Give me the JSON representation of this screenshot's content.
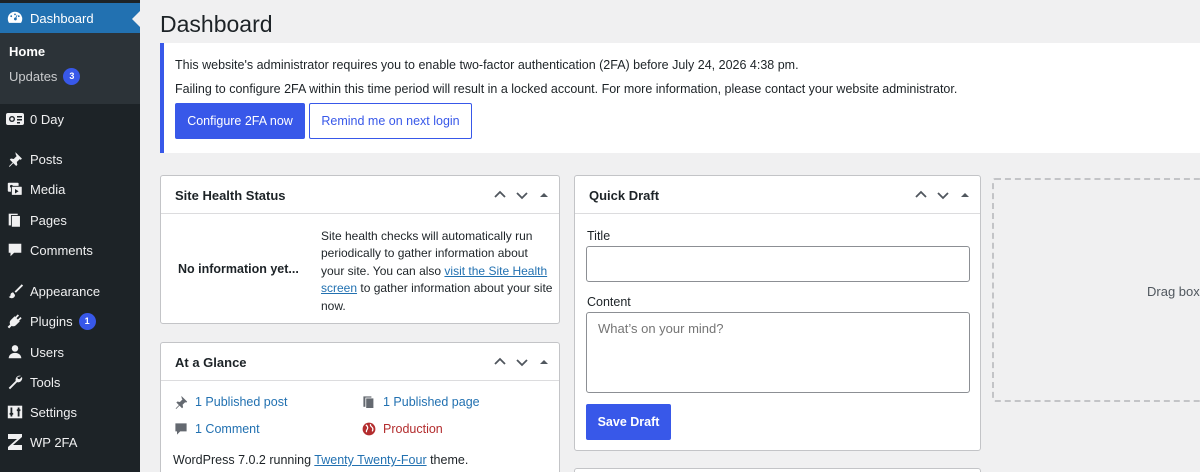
{
  "sidebar": {
    "dashboard": "Dashboard",
    "sub_home": "Home",
    "sub_updates": "Updates",
    "updates_count": "3",
    "items": [
      {
        "label": "0 Day",
        "icon": "0-day-icon"
      },
      {
        "label": "Posts",
        "icon": "pin-icon"
      },
      {
        "label": "Media",
        "icon": "media-icon"
      },
      {
        "label": "Pages",
        "icon": "pages-icon"
      },
      {
        "label": "Comments",
        "icon": "comment-icon"
      },
      {
        "label": "Appearance",
        "icon": "brush-icon"
      },
      {
        "label": "Plugins",
        "icon": "plugin-icon"
      },
      {
        "label": "Users",
        "icon": "user-icon"
      },
      {
        "label": "Tools",
        "icon": "wrench-icon"
      },
      {
        "label": "Settings",
        "icon": "settings-icon"
      },
      {
        "label": "WP 2FA",
        "icon": "wp2fa-icon"
      }
    ],
    "plugins_count": "1"
  },
  "main": {
    "title": "Dashboard",
    "notice": {
      "line1": "This website's administrator requires you to enable two-factor authentication (2FA) before July 24, 2026 4:38 pm.",
      "line2": "Failing to configure 2FA within this time period will result in a locked account. For more information, please contact your website administrator.",
      "primary_button": "Configure 2FA now",
      "secondary_button": "Remind me on next login"
    },
    "site_health": {
      "title": "Site Health Status",
      "empty": "No information yet...",
      "text_before": "Site health checks will automatically run periodically to gather information about your site. You can also ",
      "link": "visit the Site Health screen",
      "text_after": " to gather information about your site now."
    },
    "at_a_glance": {
      "title": "At a Glance",
      "posts": "1 Published post",
      "pages": "1 Published page",
      "comments": "1 Comment",
      "environment": "Production",
      "running_before": "WordPress 7.0.2 running ",
      "theme_link": "Twenty Twenty-Four",
      "running_after": " theme."
    },
    "quick_draft": {
      "title": "Quick Draft",
      "title_label": "Title",
      "title_value": "",
      "content_label": "Content",
      "content_placeholder": "What’s on your mind?",
      "save_button": "Save Draft"
    },
    "dropzone": "Drag boxes here"
  },
  "colors": {
    "sidebar_bg": "#1d2327",
    "accent": "#3858e9",
    "current_menu": "#2271b1",
    "production": "#b32d2e"
  }
}
